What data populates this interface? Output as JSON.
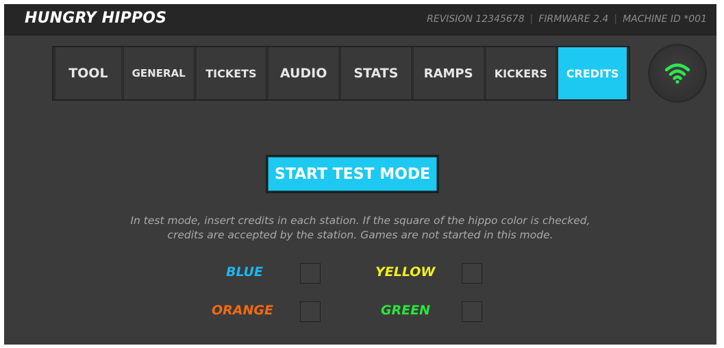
{
  "app": {
    "title": "HUNGRY HIPPOS",
    "revision": "REVISION 12345678",
    "firmware": "FIRMWARE 2.4",
    "machine_id": "MACHINE ID *001"
  },
  "tabs": [
    {
      "label": "TOOL"
    },
    {
      "label": "GENERAL"
    },
    {
      "label": "TICKETS"
    },
    {
      "label": "AUDIO"
    },
    {
      "label": "STATS"
    },
    {
      "label": "RAMPS"
    },
    {
      "label": "KICKERS"
    },
    {
      "label": "CREDITS",
      "active": true
    }
  ],
  "connection": {
    "icon": "wifi-icon",
    "color": "#2fe64f"
  },
  "test_mode": {
    "button_label": "START TEST MODE",
    "instructions_line1": "In test mode, insert credits in each station. If the square of the hippo color is checked,",
    "instructions_line2": "credits are accepted by the station. Games are not started in this mode."
  },
  "stations": [
    {
      "name": "BLUE",
      "color": "#1fb6ee",
      "checked": false
    },
    {
      "name": "YELLOW",
      "color": "#f2ef1b",
      "checked": false
    },
    {
      "name": "ORANGE",
      "color": "#f26a12",
      "checked": false
    },
    {
      "name": "GREEN",
      "color": "#29e63b",
      "checked": false
    }
  ],
  "colors": {
    "accent": "#1ec9f1",
    "background": "#3b3b3b",
    "header": "#262626"
  }
}
